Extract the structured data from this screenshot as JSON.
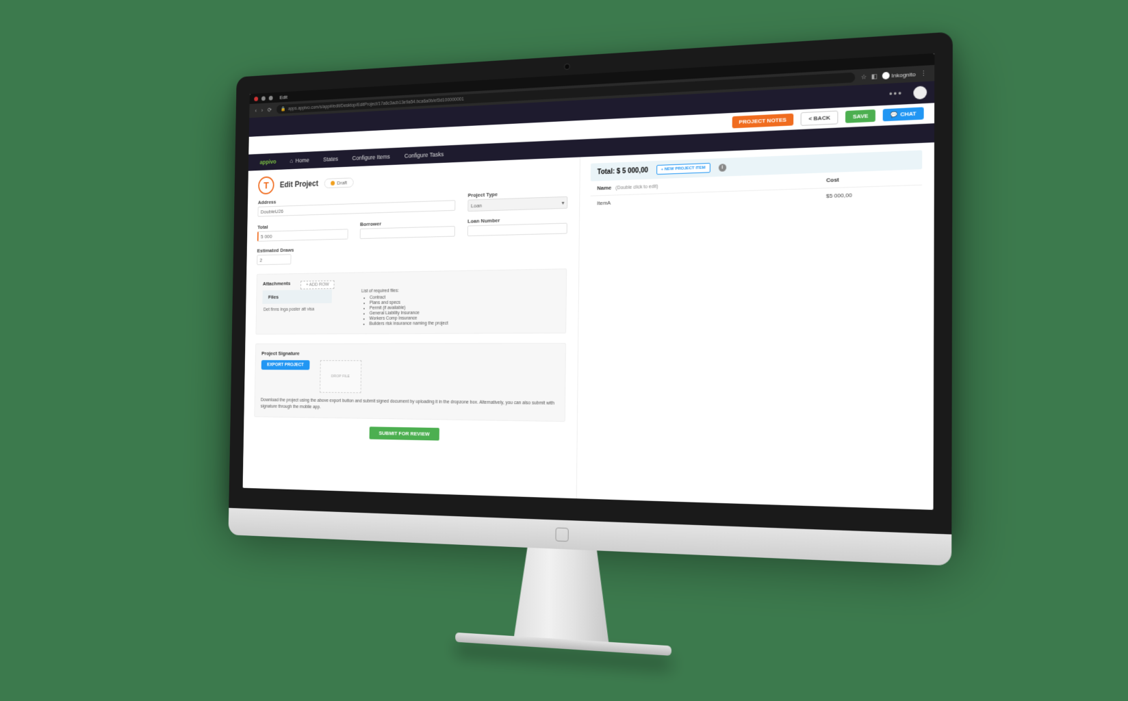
{
  "os": {
    "title": "Edit"
  },
  "browser": {
    "url": "apps.appivo.com/s/app#/edit/Desktop/EditProject/17a6c3acb13e9a54.bca6a0b/ef3d100000001",
    "incognito": "Inkognito"
  },
  "topbar": {
    "dots": "•••"
  },
  "actions": {
    "notes": "PROJECT NOTES",
    "back": "< BACK",
    "save": "SAVE",
    "chat": "CHAT"
  },
  "nav": {
    "brand": "appivo",
    "home": "Home",
    "states": "States",
    "cfg_items": "Configure Items",
    "cfg_tasks": "Configure Tasks"
  },
  "page": {
    "title": "Edit Project",
    "status": "Draft"
  },
  "form": {
    "address_label": "Address",
    "address_value": "DoubleU26",
    "project_type_label": "Project Type",
    "project_type_value": "Loan",
    "total_label": "Total",
    "total_value": "5 000",
    "borrower_label": "Borrower",
    "borrower_value": "",
    "loan_number_label": "Loan Number",
    "loan_number_value": "",
    "est_draws_label": "Estimated Draws",
    "est_draws_value": "2"
  },
  "attachments": {
    "title": "Attachments",
    "add_row": "+ ADD ROW",
    "files_header": "Files",
    "empty": "Det finns inga poster att visa",
    "required_title": "List of required files:",
    "required": [
      "Contract",
      "Plans and specs",
      "Permit (if available)",
      "General Liability Insurance",
      "Workers Comp Insurance",
      "Builders risk insurance naming the project"
    ]
  },
  "signature": {
    "title": "Project Signature",
    "export": "EXPORT PROJECT",
    "drop": "DROP FILE",
    "help": "Download the project using the above export button and submit signed document by uploading it in the dropzone box. Alternatively, you can also submit with signature through the mobile app."
  },
  "submit": "SUBMIT FOR REVIEW",
  "items": {
    "total_label": "Total:  $",
    "total_value": "5 000,00",
    "new_item": "+ NEW PROJECT ITEM",
    "col_name": "Name",
    "col_name_hint": "(Double click to edit)",
    "col_cost": "Cost",
    "rows": [
      {
        "name": "ItemA",
        "cost": "$5 000,00"
      }
    ]
  }
}
